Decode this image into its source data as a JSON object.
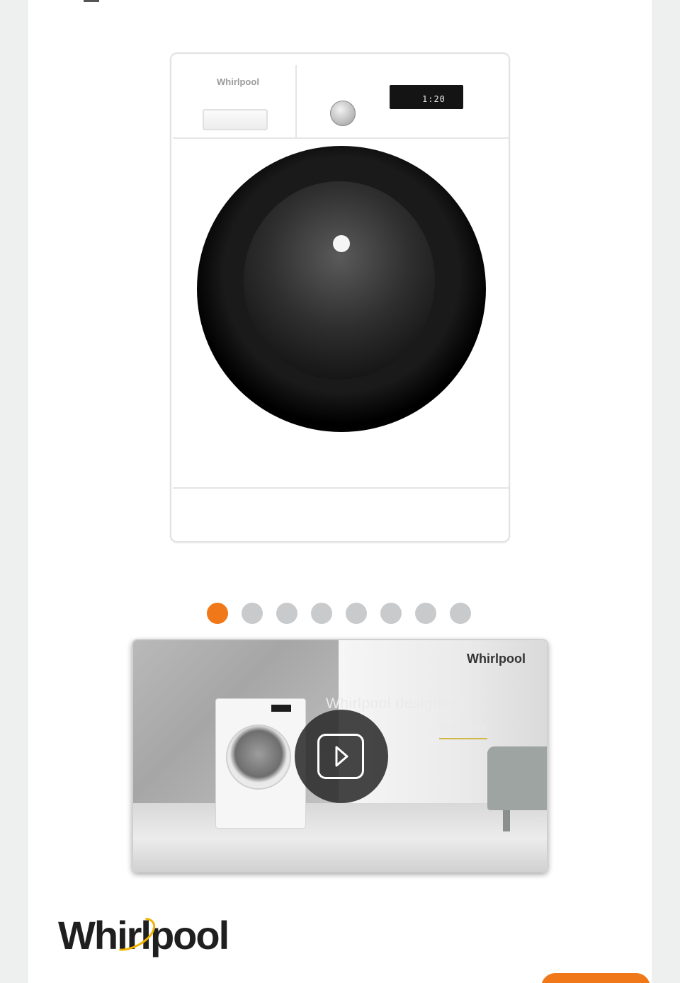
{
  "product_image": {
    "brand": "Whirlpool",
    "display_value": "1:20"
  },
  "carousel": {
    "total_slides": 8,
    "active_index": 0,
    "active_color": "#f07818",
    "inactive_color": "#c8cacb"
  },
  "video": {
    "brand": "Whirlpool",
    "tagline_line1": "Whirlpool designed",
    "tagline_line2": "for you",
    "play_icon": "play-icon"
  },
  "brand_logo": {
    "text": "Whirlpool",
    "swoosh_color": "#f0b400"
  },
  "colors": {
    "accent": "#f07818",
    "page_bg": "#eef0f0"
  }
}
